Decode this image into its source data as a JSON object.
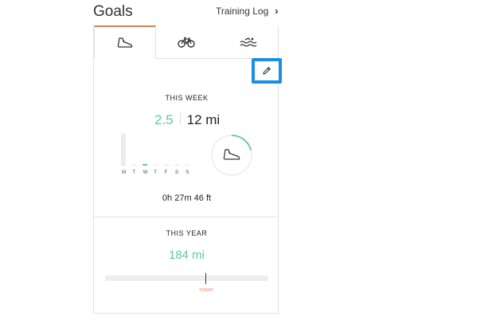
{
  "header": {
    "title": "Goals",
    "training_log_label": "Training Log",
    "chevron": "›"
  },
  "tabs": [
    {
      "icon": "shoe-icon",
      "active": true
    },
    {
      "icon": "bike-icon",
      "active": false
    },
    {
      "icon": "swim-icon",
      "active": false
    }
  ],
  "edit_button": {
    "icon": "pencil-icon"
  },
  "this_week": {
    "label": "THIS WEEK",
    "current": "2.5",
    "goal": "12 mi",
    "days": [
      "M",
      "T",
      "W",
      "T",
      "F",
      "S",
      "S"
    ],
    "daily_progress": [
      0,
      0,
      0.25,
      0,
      0,
      0,
      0
    ],
    "ring_progress": 0.21,
    "duration": "0h 27m 46 ft"
  },
  "this_year": {
    "label": "THIS YEAR",
    "value": "184 mi",
    "today_label": "TODAY"
  },
  "colors": {
    "accent_green": "#5fc8a8",
    "tab_active": "#c9835a",
    "edit_highlight": "#1a8fe3",
    "today": "#e0735a"
  }
}
